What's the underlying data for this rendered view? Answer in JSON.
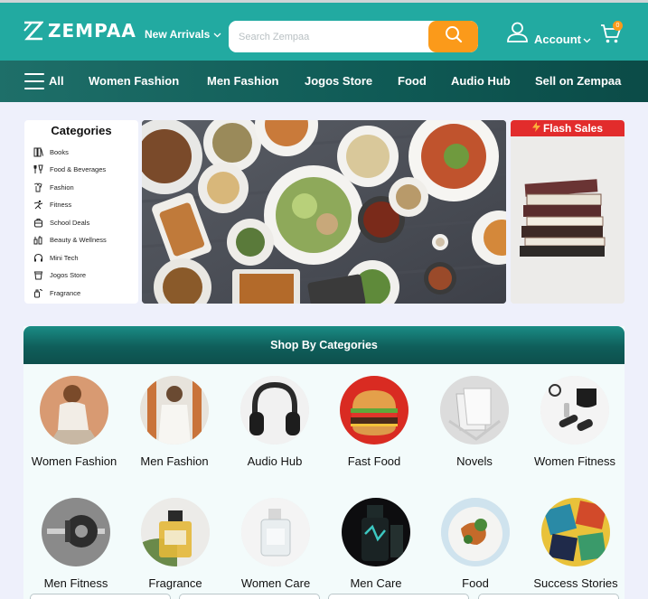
{
  "brand": {
    "name": "ZEMPAA"
  },
  "header": {
    "new_arrivals": "New Arrivals",
    "search_placeholder": "Search Zempaa",
    "account_label": "Account",
    "cart_count": "0"
  },
  "nav": {
    "all_label": "All",
    "items": [
      "Women Fashion",
      "Men Fashion",
      "Jogos Store",
      "Food",
      "Audio Hub",
      "Sell on Zempaa"
    ]
  },
  "sidebar": {
    "title": "Categories",
    "items": [
      {
        "label": "Books",
        "icon": "books-icon"
      },
      {
        "label": "Food & Beverages",
        "icon": "food-beverages-icon"
      },
      {
        "label": "Fashion",
        "icon": "fashion-icon"
      },
      {
        "label": "Fitness",
        "icon": "fitness-icon"
      },
      {
        "label": "School Deals",
        "icon": "school-deals-icon"
      },
      {
        "label": "Beauty & Wellness",
        "icon": "beauty-wellness-icon"
      },
      {
        "label": "Mini Tech",
        "icon": "headphones-icon"
      },
      {
        "label": "Jogos Store",
        "icon": "jogos-store-icon"
      },
      {
        "label": "Fragrance",
        "icon": "fragrance-icon"
      }
    ]
  },
  "flash": {
    "title": "Flash Sales"
  },
  "shop": {
    "title": "Shop By Categories",
    "tiles": [
      "Women Fashion",
      "Men Fashion",
      "Audio Hub",
      "Fast Food",
      "Novels",
      "Women Fitness",
      "Men Fitness",
      "Fragrance",
      "Women Care",
      "Men Care",
      "Food",
      "Success Stories"
    ]
  },
  "colors": {
    "header_teal": "#22aaa1",
    "nav_dark_teal": "#0f5a55",
    "accent_orange": "#fb9a1a",
    "flash_red": "#e22c2c",
    "page_bg": "#eef0fb"
  }
}
